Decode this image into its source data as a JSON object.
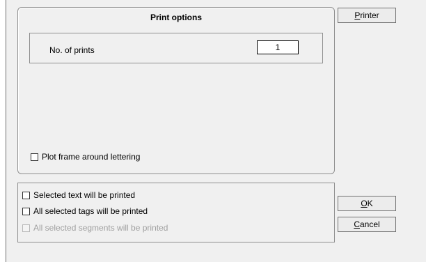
{
  "print_options": {
    "title": "Print options",
    "prints_label": "No. of prints",
    "prints_value": "1",
    "plot_frame": {
      "label": "Plot frame around lettering",
      "checked": false
    }
  },
  "selection": {
    "items": [
      {
        "label": "Selected text will be printed",
        "checked": false,
        "enabled": true
      },
      {
        "label": "All selected tags will be printed",
        "checked": false,
        "enabled": true
      },
      {
        "label": "All selected segments will be printed",
        "checked": false,
        "enabled": false
      }
    ]
  },
  "buttons": {
    "printer": {
      "mnemonic": "P",
      "rest": "rinter"
    },
    "ok": {
      "mnemonic": "O",
      "rest": "K"
    },
    "cancel": {
      "mnemonic": "C",
      "rest": "ancel"
    }
  }
}
